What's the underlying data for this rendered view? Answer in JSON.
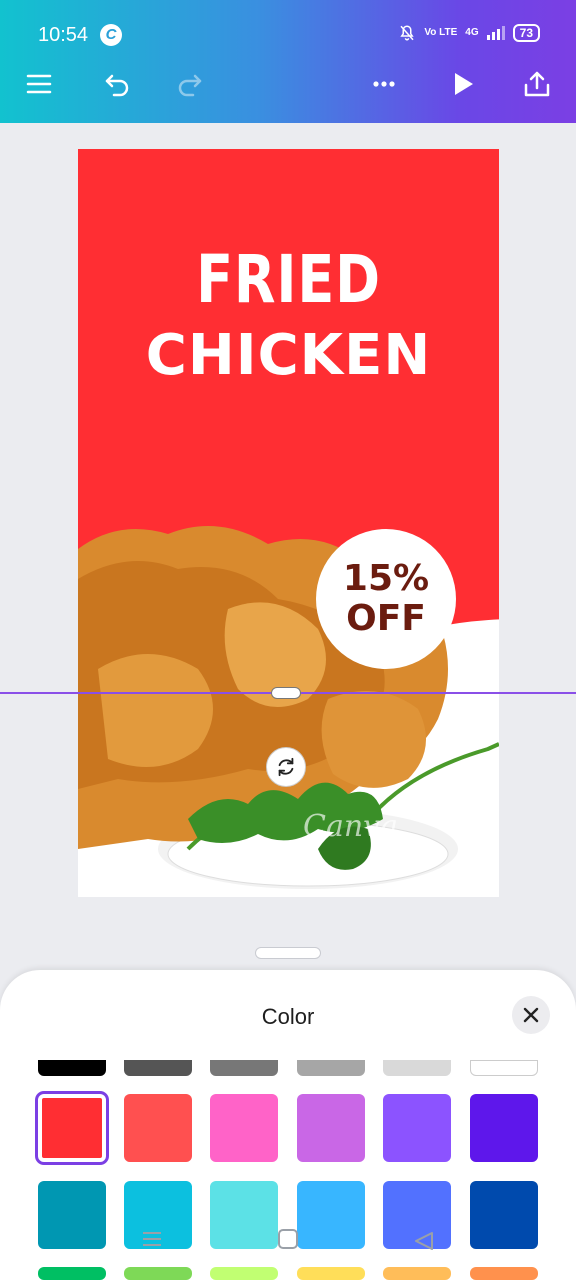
{
  "status_bar": {
    "time": "10:54",
    "app_badge": "C",
    "network_type": "Vo LTE",
    "net_speed": "4G",
    "battery": "73"
  },
  "toolbar": {
    "icons": [
      "menu-icon",
      "undo-icon",
      "redo-icon",
      "more-icon",
      "play-icon",
      "share-icon"
    ]
  },
  "design": {
    "headline_1": "FRIED",
    "headline_2": "CHICKEN",
    "badge_line_1": "15%",
    "badge_line_2": "OFF",
    "watermark": "Canva",
    "colors": {
      "background": "#ff2e33",
      "badge_text": "#6b1c0f"
    }
  },
  "sheet": {
    "title": "Color",
    "swatch_rows": [
      [
        "#000000",
        "#555555",
        "#777777",
        "#a6a6a6",
        "#d9d9d9",
        "#ffffff"
      ],
      [
        "#ff2e33",
        "#ff5050",
        "#ff63c8",
        "#c967e6",
        "#8c53ff",
        "#5e17eb"
      ],
      [
        "#0097b2",
        "#0cc0df",
        "#5ce1e6",
        "#38b6ff",
        "#5271ff",
        "#004aad"
      ],
      [
        "#00bf63",
        "#7ed957",
        "#c1ff72",
        "#ffde59",
        "#ffbd59",
        "#ff914d"
      ]
    ],
    "selected_color": "#ff2e33"
  }
}
